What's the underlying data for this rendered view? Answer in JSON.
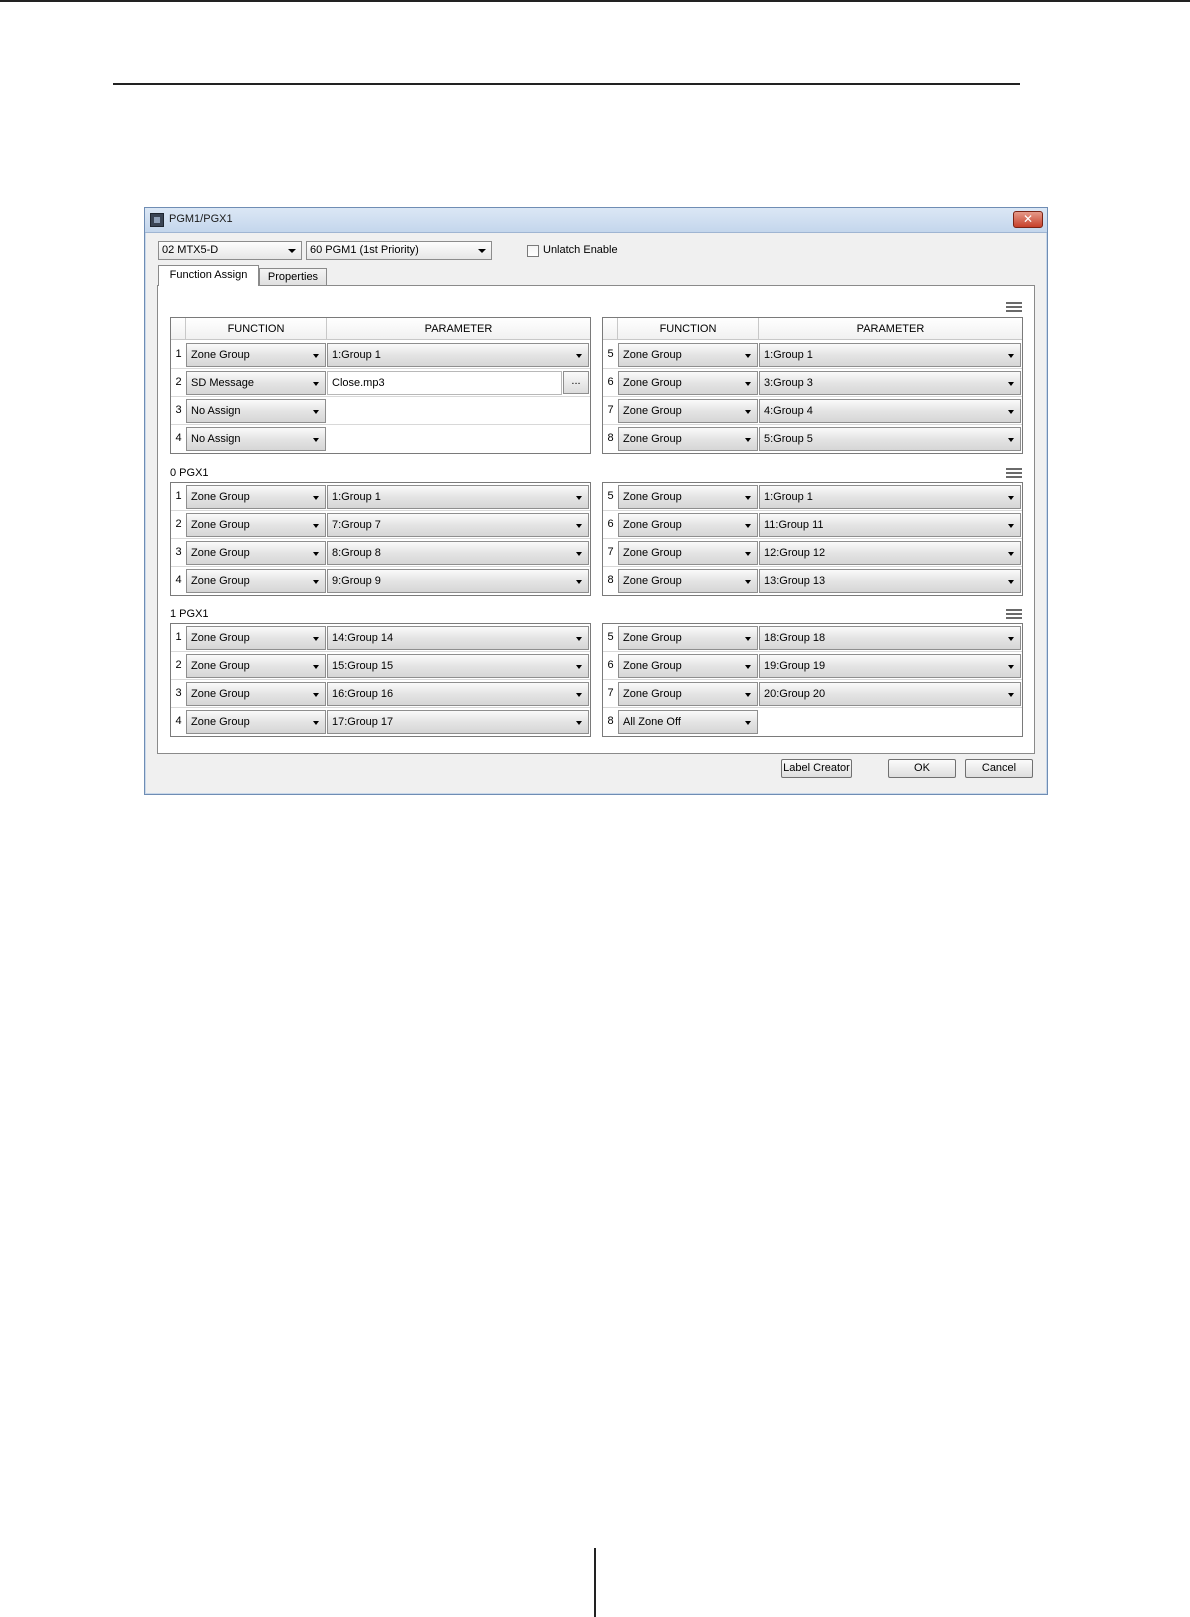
{
  "window": {
    "title": "PGM1/PGX1",
    "close_label": "✕",
    "device_select": "02 MTX5-D",
    "id_select": "60 PGM1 (1st Priority)",
    "unlatch_label": "Unlatch Enable"
  },
  "tabs": [
    "Function Assign",
    "Properties"
  ],
  "columns": {
    "function": "FUNCTION",
    "parameter": "PARAMETER"
  },
  "sections": [
    {
      "label": "",
      "left": [
        {
          "n": "1",
          "f": "Zone Group",
          "p": "1:Group 1"
        },
        {
          "n": "2",
          "f": "SD Message",
          "p": "Close.mp3",
          "browse": "..."
        },
        {
          "n": "3",
          "f": "No Assign",
          "p": ""
        },
        {
          "n": "4",
          "f": "No Assign",
          "p": ""
        }
      ],
      "right": [
        {
          "n": "5",
          "f": "Zone Group",
          "p": "1:Group 1"
        },
        {
          "n": "6",
          "f": "Zone Group",
          "p": "3:Group 3"
        },
        {
          "n": "7",
          "f": "Zone Group",
          "p": "4:Group 4"
        },
        {
          "n": "8",
          "f": "Zone Group",
          "p": "5:Group 5"
        }
      ]
    },
    {
      "label": "0 PGX1",
      "left": [
        {
          "n": "1",
          "f": "Zone Group",
          "p": "1:Group 1"
        },
        {
          "n": "2",
          "f": "Zone Group",
          "p": "7:Group 7"
        },
        {
          "n": "3",
          "f": "Zone Group",
          "p": "8:Group 8"
        },
        {
          "n": "4",
          "f": "Zone Group",
          "p": "9:Group 9"
        }
      ],
      "right": [
        {
          "n": "5",
          "f": "Zone Group",
          "p": "1:Group 1"
        },
        {
          "n": "6",
          "f": "Zone Group",
          "p": "11:Group 11"
        },
        {
          "n": "7",
          "f": "Zone Group",
          "p": "12:Group 12"
        },
        {
          "n": "8",
          "f": "Zone Group",
          "p": "13:Group 13"
        }
      ]
    },
    {
      "label": "1 PGX1",
      "left": [
        {
          "n": "1",
          "f": "Zone Group",
          "p": "14:Group 14"
        },
        {
          "n": "2",
          "f": "Zone Group",
          "p": "15:Group 15"
        },
        {
          "n": "3",
          "f": "Zone Group",
          "p": "16:Group 16"
        },
        {
          "n": "4",
          "f": "Zone Group",
          "p": "17:Group 17"
        }
      ],
      "right": [
        {
          "n": "5",
          "f": "Zone Group",
          "p": "18:Group 18"
        },
        {
          "n": "6",
          "f": "Zone Group",
          "p": "19:Group 19"
        },
        {
          "n": "7",
          "f": "Zone Group",
          "p": "20:Group 20"
        },
        {
          "n": "8",
          "f": "All Zone Off",
          "p": ""
        }
      ]
    }
  ],
  "buttons": {
    "label_creator": "Label Creator",
    "ok": "OK",
    "cancel": "Cancel"
  }
}
